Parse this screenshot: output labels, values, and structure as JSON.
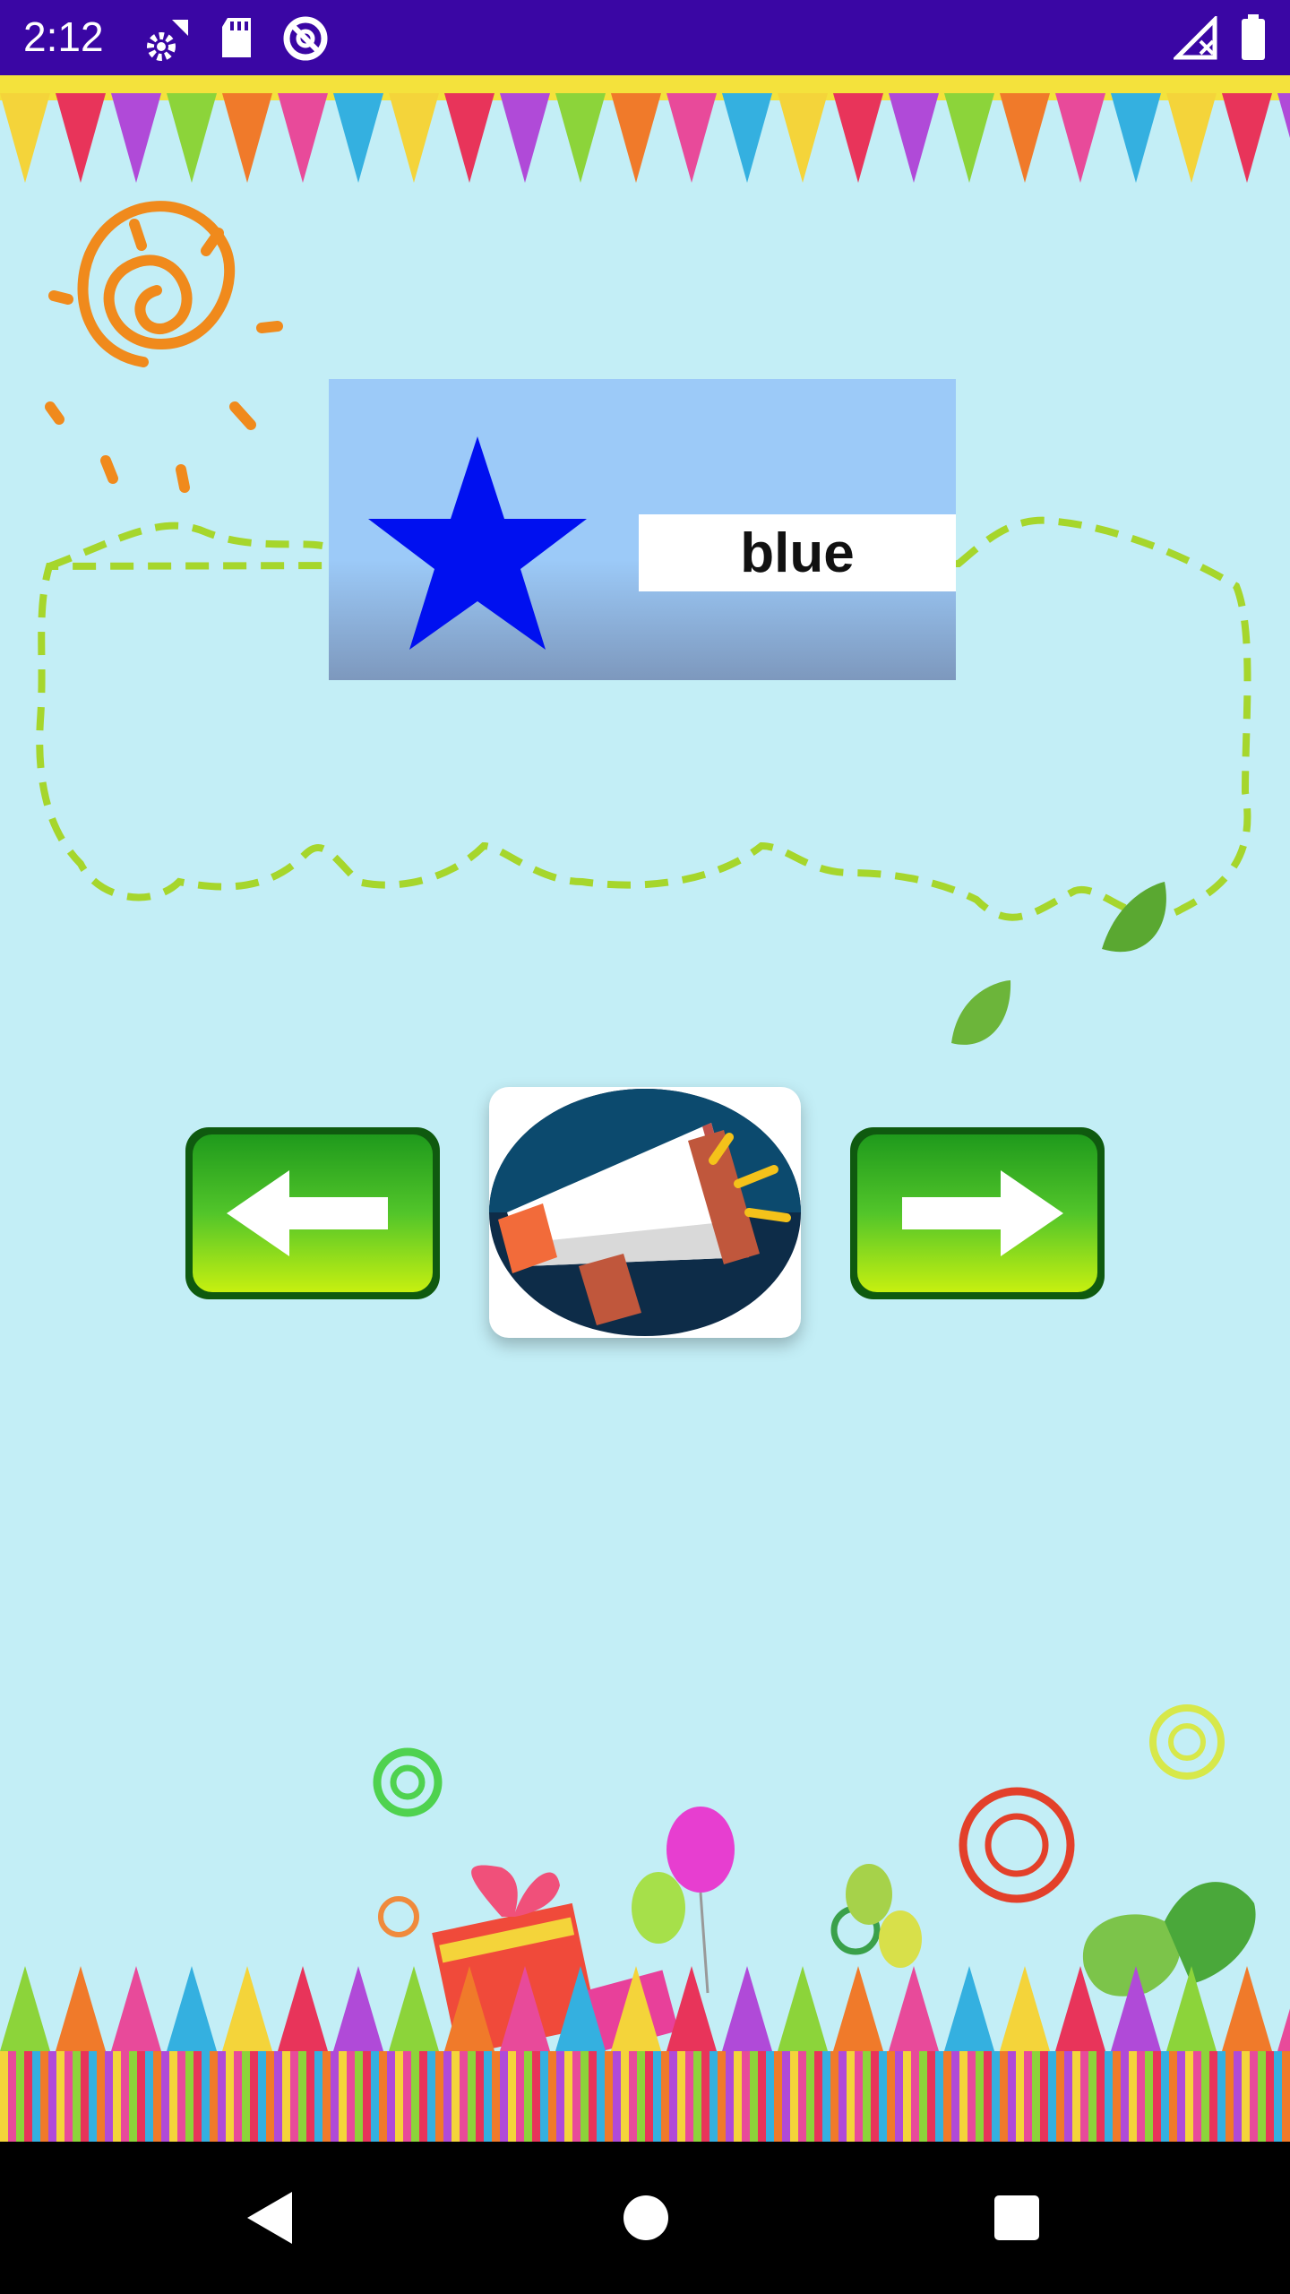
{
  "status_bar": {
    "time": "2:12",
    "icons": [
      "settings-icon",
      "sd-card-icon",
      "circle-slash-icon",
      "signal-icon",
      "battery-icon"
    ],
    "background_color": "#3a06a4"
  },
  "app": {
    "background_color": "#c3eef6",
    "card": {
      "shape": "star",
      "shape_color": "#0010f0",
      "word": "blue"
    },
    "buttons": {
      "previous": "left-arrow-icon",
      "speak": "megaphone-icon",
      "next": "right-arrow-icon"
    }
  },
  "nav_bar": {
    "buttons": [
      "back-icon",
      "home-icon",
      "recents-icon"
    ]
  }
}
